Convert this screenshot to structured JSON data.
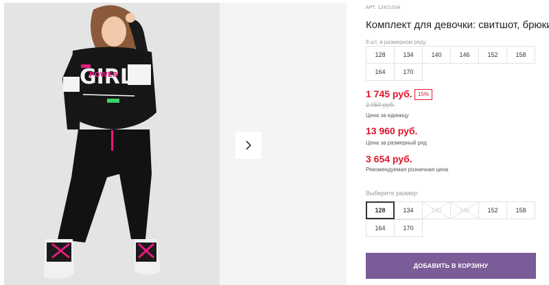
{
  "product": {
    "article": "АРТ. 12421034",
    "title": "Комплект для девочки: свитшот, брюки"
  },
  "pack_sizes": {
    "label": "8 шт. в размерном ряду",
    "sizes": [
      "128",
      "134",
      "140",
      "146",
      "152",
      "158",
      "164",
      "170"
    ]
  },
  "pricing": {
    "price": "1 745 руб.",
    "discount": "15%",
    "old_price": "2 050 руб.",
    "unit_caption": "Цена за единицу",
    "row_price": "13 960 руб.",
    "row_caption": "Цена за размерный ряд",
    "rrp": "3 654 руб.",
    "rrp_caption": "Рекомендуемая розничная цена"
  },
  "size_select": {
    "label": "Выберите размер:",
    "sizes": [
      {
        "value": "128",
        "state": "selected"
      },
      {
        "value": "134",
        "state": "available"
      },
      {
        "value": "140",
        "state": "disabled"
      },
      {
        "value": "146",
        "state": "disabled"
      },
      {
        "value": "152",
        "state": "available"
      },
      {
        "value": "158",
        "state": "available"
      },
      {
        "value": "164",
        "state": "available"
      },
      {
        "value": "170",
        "state": "available"
      }
    ]
  },
  "cart": {
    "add_label": "ДОБАВИТЬ В КОРЗИНУ"
  },
  "gallery": {
    "next_icon": "chevron-right-icon",
    "print_text": "GIRL",
    "print_subtext": "POWER"
  },
  "colors": {
    "price_red": "#e0122a",
    "button_purple": "#7a5c98",
    "accent_pink": "#e8197a"
  }
}
